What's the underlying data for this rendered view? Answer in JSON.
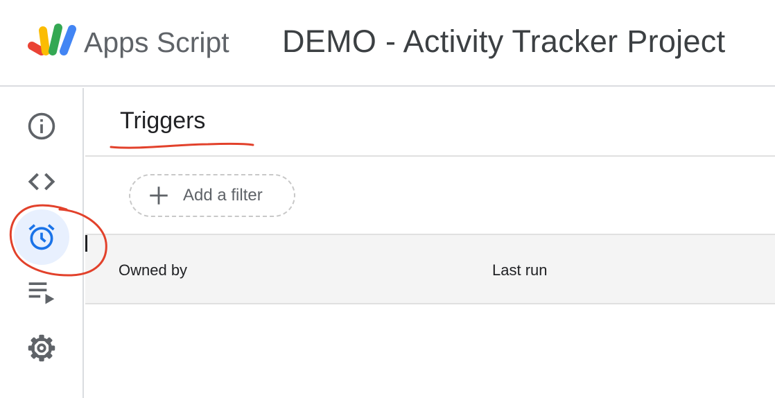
{
  "header": {
    "app_name": "Apps Script",
    "project_title": "DEMO - Activity Tracker Project",
    "logo_icon": "apps-script-logo-icon"
  },
  "rail": {
    "items": [
      {
        "icon": "info-icon",
        "active": false
      },
      {
        "icon": "code-icon",
        "active": false
      },
      {
        "icon": "alarm-clock-icon",
        "active": true
      },
      {
        "icon": "executions-icon",
        "active": false
      },
      {
        "icon": "gear-icon",
        "active": false
      }
    ]
  },
  "main": {
    "title": "Triggers",
    "filter": {
      "label": "Add a filter",
      "icon": "plus-icon"
    },
    "table": {
      "columns": [
        "Owned by",
        "Last run"
      ]
    }
  },
  "colors": {
    "accent": "#1a73e8",
    "active_bg": "#e8f0fe",
    "annotation_red": "#e2412b"
  }
}
